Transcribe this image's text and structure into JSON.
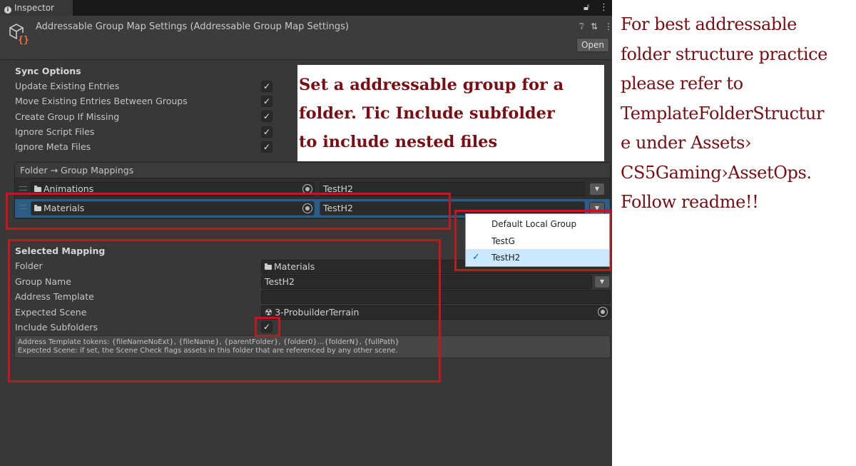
{
  "tab": {
    "label": "Inspector"
  },
  "header": {
    "title": "Addressable Group Map Settings (Addressable Group Map Settings)",
    "open_label": "Open"
  },
  "sync_options": {
    "title": "Sync Options",
    "items": [
      {
        "label": "Update Existing Entries",
        "checked": true
      },
      {
        "label": "Move Existing Entries Between Groups",
        "checked": true
      },
      {
        "label": "Create Group If Missing",
        "checked": true
      },
      {
        "label": "Ignore Script Files",
        "checked": true
      },
      {
        "label": "Ignore Meta Files",
        "checked": true
      }
    ]
  },
  "annotation_center": {
    "lines": [
      "Set a addressable group for a",
      "folder. Tic Include subfolder",
      "to include nested files"
    ]
  },
  "mappings": {
    "header": "Folder → Group Mappings",
    "rows": [
      {
        "folder": "Animations",
        "group": "TestH2",
        "selected": false
      },
      {
        "folder": "Materials",
        "group": "TestH2",
        "selected": true
      }
    ]
  },
  "popup": {
    "options": [
      {
        "label": "Default Local Group",
        "selected": false
      },
      {
        "label": "TestG",
        "selected": false
      },
      {
        "label": "TestH2",
        "selected": true
      }
    ],
    "check_glyph": "✓"
  },
  "selected_mapping": {
    "title": "Selected Mapping",
    "folder_label": "Folder",
    "folder_value": "Materials",
    "group_name_label": "Group Name",
    "group_name_value": "TestH2",
    "address_template_label": "Address Template",
    "address_template_value": "",
    "expected_scene_label": "Expected Scene",
    "expected_scene_value": "3-ProbuilderTerrain",
    "include_subfolders_label": "Include Subfolders",
    "include_subfolders_checked": true
  },
  "info": {
    "line1": "Address Template tokens: {fileNameNoExt}, {fileName}, {parentFolder}, {folder0}...{folderN}, {fullPath}",
    "line2": "Expected Scene: if set, the Scene Check flags assets in this folder that are referenced by any other scene."
  },
  "annotation_right": {
    "lines": [
      "For best addressable",
      "folder structure practice",
      "please refer to",
      "TemplateFolderStructur",
      "e under Assets›",
      "CS5Gaming›AssetOps.",
      "Follow readme!!"
    ]
  },
  "glyphs": {
    "check": "✓",
    "dropdown": "▼",
    "scene": "☢"
  },
  "colors": {
    "annotation": "#7a0c12",
    "highlight_box": "#c4161c",
    "selected_row": "#2c5d87",
    "popup_selected": "#cce8ff"
  }
}
